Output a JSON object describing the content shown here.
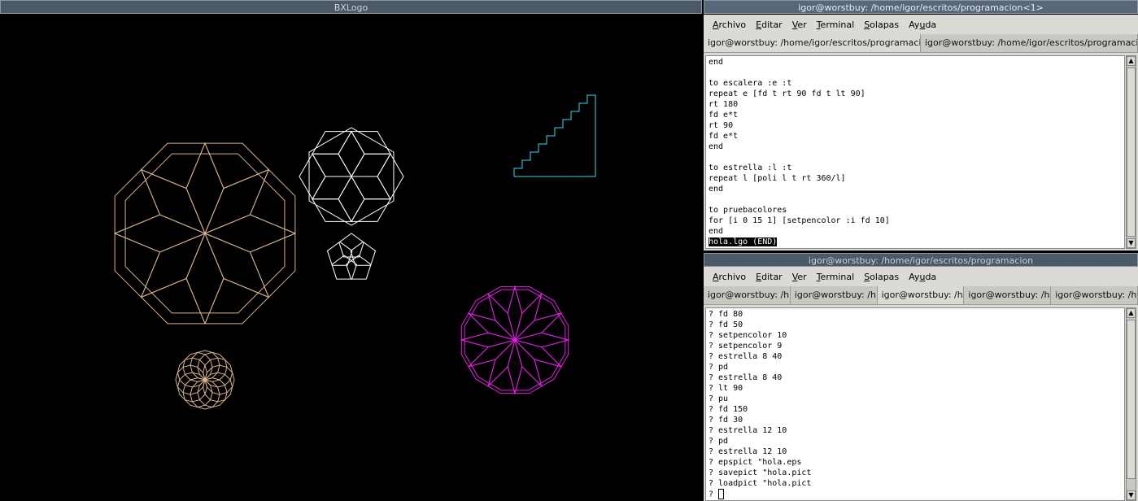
{
  "logo_window": {
    "title": "BXLogo"
  },
  "term1": {
    "title": "igor@worstbuy: /home/igor/escritos/programacion<1>",
    "menu": [
      {
        "pre": "",
        "u": "A",
        "post": "rchivo"
      },
      {
        "pre": "",
        "u": "E",
        "post": "ditar"
      },
      {
        "pre": "",
        "u": "V",
        "post": "er"
      },
      {
        "pre": "",
        "u": "T",
        "post": "erminal"
      },
      {
        "pre": "",
        "u": "S",
        "post": "olapas"
      },
      {
        "pre": "Ay",
        "u": "u",
        "post": "da"
      }
    ],
    "tabs": [
      "igor@worstbuy: /home/igor/escritos/programacion",
      "igor@worstbuy: /home/igor/escritos/programacion"
    ],
    "lines": [
      "end",
      "",
      "to escalera :e :t",
      "repeat e [fd t rt 90 fd t lt 90]",
      "rt 180",
      "fd e*t",
      "rt 90",
      "fd e*t",
      "end",
      "",
      "to estrella :l :t",
      "repeat l [poli l t rt 360/l]",
      "end",
      "",
      "to pruebacolores",
      "for [i 0 15 1] [setpencolor :i fd 10]",
      "end"
    ],
    "status_line": "hola.lgo (END)"
  },
  "term2": {
    "title": "igor@worstbuy: /home/igor/escritos/programacion",
    "menu": [
      {
        "pre": "",
        "u": "A",
        "post": "rchivo"
      },
      {
        "pre": "",
        "u": "E",
        "post": "ditar"
      },
      {
        "pre": "",
        "u": "V",
        "post": "er"
      },
      {
        "pre": "",
        "u": "T",
        "post": "erminal"
      },
      {
        "pre": "",
        "u": "S",
        "post": "olapas"
      },
      {
        "pre": "Ay",
        "u": "u",
        "post": "da"
      }
    ],
    "tabs": [
      "igor@worstbuy: /h...",
      "igor@worstbuy: /h...",
      "igor@worstbuy: /h...",
      "igor@worstbuy: /h...",
      "igor@worstbuy: /h..."
    ],
    "active_tab": 2,
    "lines": [
      "? fd 80",
      "? fd 50",
      "? setpencolor 10",
      "? setpencolor 9",
      "? estrella 8 40",
      "? pd",
      "? estrella 8 40",
      "? lt 90",
      "? pu",
      "? fd 150",
      "? fd 30",
      "? estrella 12 10",
      "? pd",
      "? estrella 12 10",
      "? epspict \"hola.eps",
      "? savepict \"hola.pict",
      "? loadpict \"hola.pict"
    ],
    "prompt": "? "
  },
  "colors": {
    "tan": "#d8b48c",
    "white": "#ffffff",
    "cyan": "#30d8e8",
    "magenta": "#e020e0"
  }
}
